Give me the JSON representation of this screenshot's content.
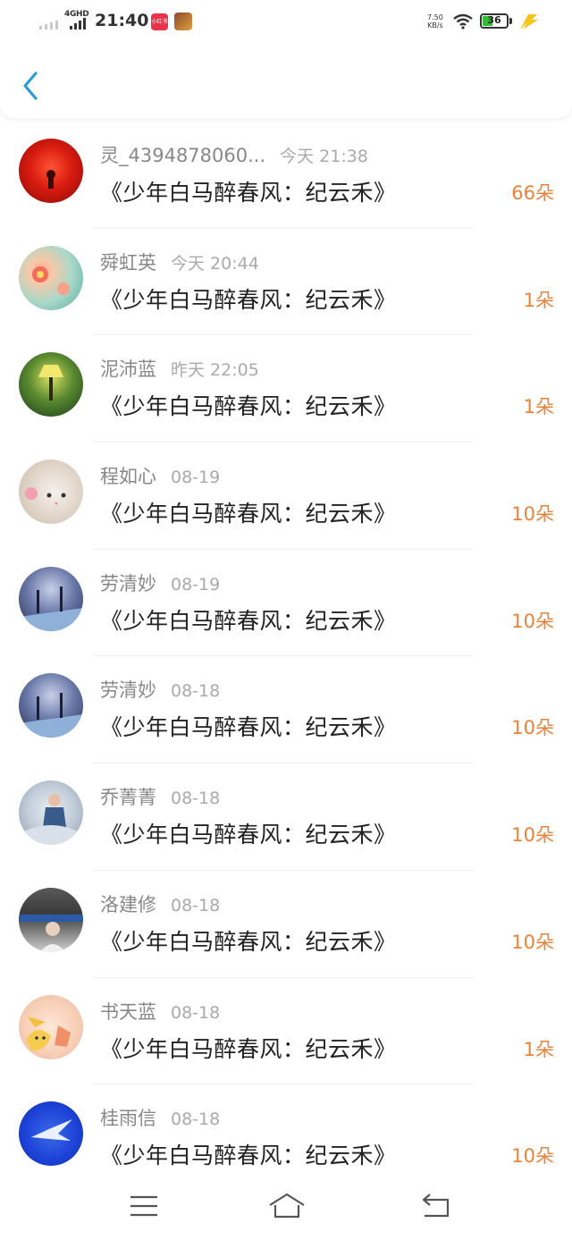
{
  "status_bar": {
    "network": "4GHD",
    "time": "21:40",
    "app1_label": "小红书",
    "speed_value": "7.50",
    "speed_unit": "KB/s",
    "battery": "36",
    "colors": {
      "battery_fill": "#33bb33",
      "charging": "#f5c518"
    }
  },
  "header": {
    "back_icon": "chevron-left-icon",
    "accent": "#2d9cdb"
  },
  "list": [
    {
      "user": "灵_4394878060...",
      "time": "今天 21:38",
      "book": "《少年白马醉春风：纪云禾》",
      "count": "66朵"
    },
    {
      "user": "舜虹英",
      "time": "今天 20:44",
      "book": "《少年白马醉春风：纪云禾》",
      "count": "1朵"
    },
    {
      "user": "泥沛蓝",
      "time": "昨天 22:05",
      "book": "《少年白马醉春风：纪云禾》",
      "count": "1朵"
    },
    {
      "user": "程如心",
      "time": "08-19",
      "book": "《少年白马醉春风：纪云禾》",
      "count": "10朵"
    },
    {
      "user": "劳清妙",
      "time": "08-19",
      "book": "《少年白马醉春风：纪云禾》",
      "count": "10朵"
    },
    {
      "user": "劳清妙",
      "time": "08-18",
      "book": "《少年白马醉春风：纪云禾》",
      "count": "10朵"
    },
    {
      "user": "乔菁菁",
      "time": "08-18",
      "book": "《少年白马醉春风：纪云禾》",
      "count": "10朵"
    },
    {
      "user": "洛建修",
      "time": "08-18",
      "book": "《少年白马醉春风：纪云禾》",
      "count": "10朵"
    },
    {
      "user": "书天蓝",
      "time": "08-18",
      "book": "《少年白马醉春风：纪云禾》",
      "count": "1朵"
    },
    {
      "user": "桂雨信",
      "time": "08-18",
      "book": "《少年白马醉春风：纪云禾》",
      "count": "10朵"
    }
  ],
  "nav_bar": {
    "menu_icon": "menu-icon",
    "home_icon": "home-icon",
    "back_icon": "back-icon"
  },
  "colors": {
    "count": "#e8833a",
    "name": "#888888",
    "book_title": "#222222"
  }
}
